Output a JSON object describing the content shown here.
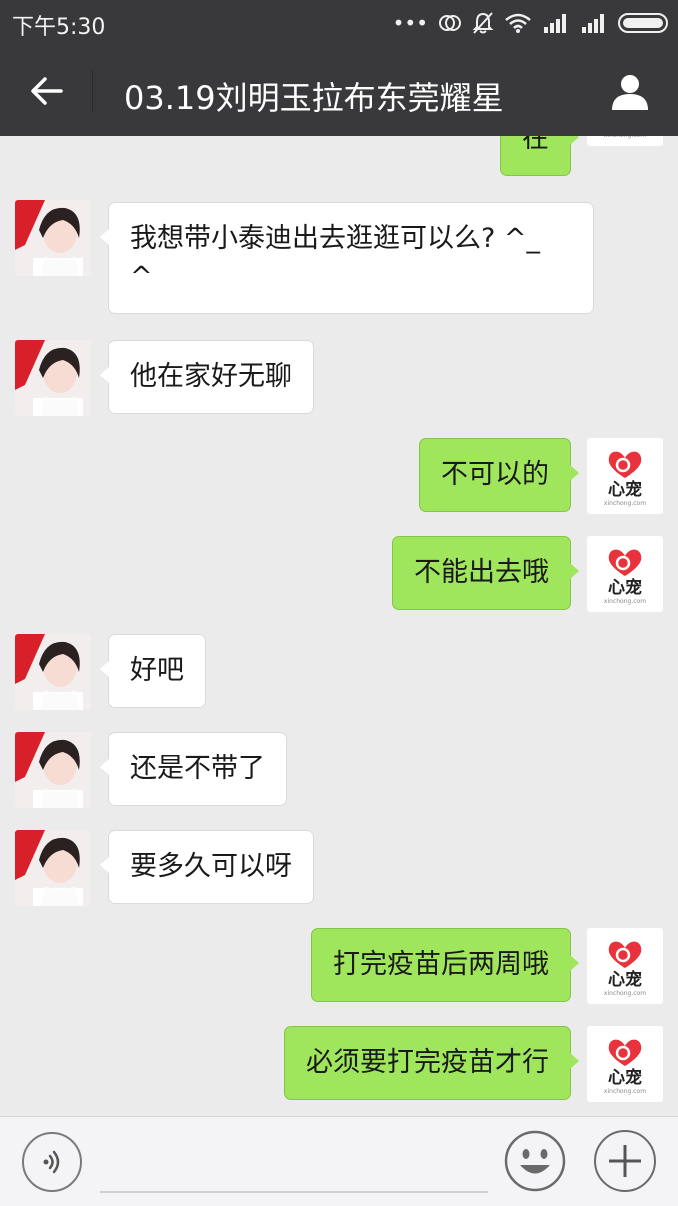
{
  "status_bar": {
    "time": "下午5:30",
    "icons": [
      "more-dots-icon",
      "sync-icon",
      "mute-bell-icon",
      "wifi-icon",
      "signal-icon",
      "signal-icon-2",
      "battery-icon"
    ]
  },
  "header": {
    "title": "03.19刘明玉拉布东莞耀星",
    "back_icon": "back-arrow-icon",
    "profile_icon": "profile-icon"
  },
  "brand": {
    "logo_text": "心宠",
    "logo_subtext": "xinchong.com",
    "heart_color": "#e8323c"
  },
  "colors": {
    "outgoing_bubble": "#9fe65c",
    "incoming_bubble": "#ffffff",
    "chat_bg": "#ebebeb",
    "bar_bg": "#39393b"
  },
  "messages": [
    {
      "side": "out",
      "text": "在"
    },
    {
      "side": "in",
      "text": "我想带小泰迪出去逛逛可以么? ^_\n^"
    },
    {
      "side": "in",
      "text": "他在家好无聊"
    },
    {
      "side": "out",
      "text": "不可以的"
    },
    {
      "side": "out",
      "text": "不能出去哦"
    },
    {
      "side": "in",
      "text": "好吧"
    },
    {
      "side": "in",
      "text": "还是不带了"
    },
    {
      "side": "in",
      "text": "要多久可以呀"
    },
    {
      "side": "out",
      "text": "打完疫苗后两周哦"
    },
    {
      "side": "out",
      "text": "必须要打完疫苗才行"
    }
  ],
  "input_bar": {
    "voice_icon": "voice-icon",
    "input_value": "",
    "emoji_icon": "emoji-icon",
    "plus_icon": "plus-icon"
  }
}
